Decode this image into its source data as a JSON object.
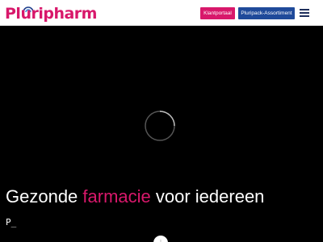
{
  "brand": {
    "logo_text": "Pluripharm",
    "logo_color": "#d8186b",
    "arc_colors": [
      "#1f3f8c",
      "#3f8ed8",
      "#d8186b"
    ]
  },
  "header": {
    "klantportaal_label": "Klantportaal",
    "pluripack_label": "Pluripack-Assortiment",
    "menu_icon": "hamburger-icon"
  },
  "colors": {
    "klantportaal_bg": "#d8186b",
    "pluripack_bg": "#1f4a9a",
    "accent": "#d8186b",
    "hero_bg": "#000000"
  },
  "hero": {
    "headline_before": "Gezonde ",
    "headline_accent": "farmacie",
    "headline_after": " voor iedereen",
    "typed_text": "P_",
    "loading_icon": "spinner-icon",
    "scroll_icon": "arrow-down-icon"
  }
}
